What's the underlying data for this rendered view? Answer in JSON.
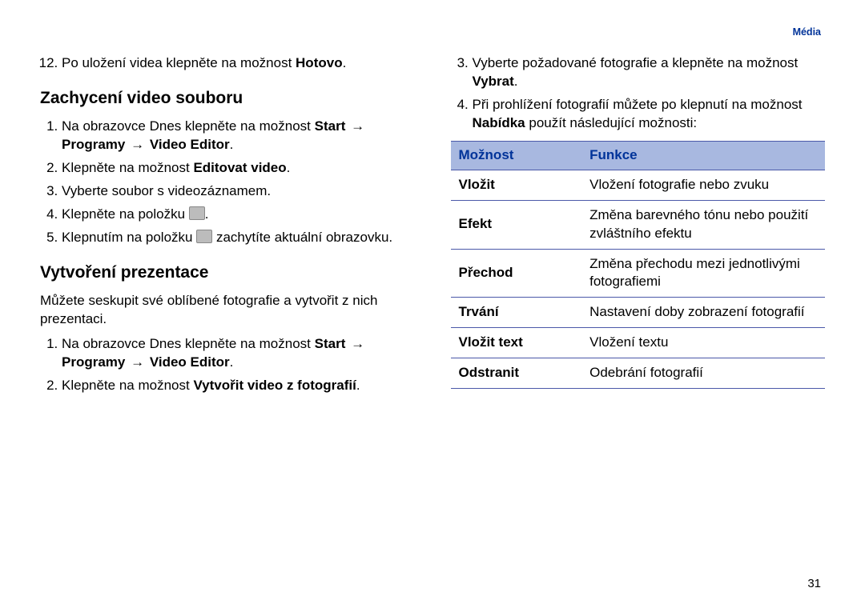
{
  "header": {
    "section": "Média"
  },
  "left": {
    "top_item": {
      "num": "12.",
      "text1": "Po uložení videa klepněte na možnost ",
      "bold1": "Hotovo",
      "text2": "."
    },
    "h1": "Zachycení video souboru",
    "steps1": [
      {
        "num": "1.",
        "parts": [
          {
            "t": "Na obrazovce Dnes klepněte na možnost "
          },
          {
            "b": "Start"
          },
          {
            "a": " → "
          },
          {
            "b": "Programy"
          },
          {
            "a": " → "
          },
          {
            "b": "Video Editor"
          },
          {
            "t": "."
          }
        ]
      },
      {
        "num": "2.",
        "parts": [
          {
            "t": "Klepněte na možnost "
          },
          {
            "b": "Editovat video"
          },
          {
            "t": "."
          }
        ]
      },
      {
        "num": "3.",
        "parts": [
          {
            "t": "Vyberte soubor s videozáznamem."
          }
        ]
      },
      {
        "num": "4.",
        "parts": [
          {
            "t": "Klepněte na položku "
          },
          {
            "icon": true
          },
          {
            "t": "."
          }
        ]
      },
      {
        "num": "5.",
        "parts": [
          {
            "t": "Klepnutím na položku "
          },
          {
            "icon": true
          },
          {
            "t": " zachytíte aktuální obrazovku."
          }
        ]
      }
    ],
    "h2": "Vytvoření prezentace",
    "intro": "Můžete seskupit své oblíbené fotografie a vytvořit z nich prezentaci.",
    "steps2": [
      {
        "num": "1.",
        "parts": [
          {
            "t": "Na obrazovce Dnes klepněte na možnost "
          },
          {
            "b": "Start"
          },
          {
            "a": " → "
          },
          {
            "b": "Programy"
          },
          {
            "a": " → "
          },
          {
            "b": "Video Editor"
          },
          {
            "t": "."
          }
        ]
      },
      {
        "num": "2.",
        "parts": [
          {
            "t": "Klepněte na možnost "
          },
          {
            "b": "Vytvořit video z fotografií"
          },
          {
            "t": "."
          }
        ]
      }
    ]
  },
  "right": {
    "steps": [
      {
        "num": "3.",
        "parts": [
          {
            "t": "Vyberte požadované fotografie a klepněte na možnost "
          },
          {
            "b": "Vybrat"
          },
          {
            "t": "."
          }
        ]
      },
      {
        "num": "4.",
        "parts": [
          {
            "t": "Při prohlížení fotografií můžete po klepnutí na možnost "
          },
          {
            "b": "Nabídka"
          },
          {
            "t": " použít následující možnosti:"
          }
        ]
      }
    ],
    "table": {
      "headers": [
        "Možnost",
        "Funkce"
      ],
      "rows": [
        {
          "opt": "Vložit",
          "func": "Vložení fotografie nebo zvuku"
        },
        {
          "opt": "Efekt",
          "func": "Změna barevného tónu nebo použití zvláštního efektu"
        },
        {
          "opt": "Přechod",
          "func": "Změna přechodu mezi jednotlivými fotografiemi"
        },
        {
          "opt": "Trvání",
          "func": "Nastavení doby zobrazení fotografií"
        },
        {
          "opt": "Vložit text",
          "func": "Vložení textu"
        },
        {
          "opt": "Odstranit",
          "func": "Odebrání fotografií"
        }
      ]
    }
  },
  "page_number": "31"
}
